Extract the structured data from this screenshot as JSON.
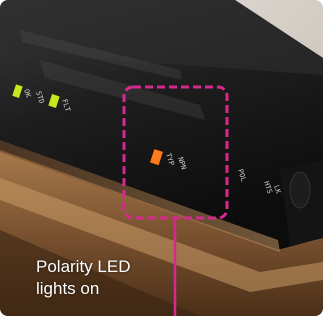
{
  "photo": {
    "subject_icon": "hardware-module-photo",
    "body_label_1": "OK",
    "body_label_2": "STD",
    "body_label_3": "FLT",
    "body_label_4": "TYP",
    "body_label_5": "NPN",
    "body_label_6": "POL",
    "body_label_7": "HTS",
    "body_label_8": "LK"
  },
  "callout": {
    "line1": "Polarity LED",
    "line2": "lights on",
    "highlight_color": "#d6298f",
    "indicator_color": "#ff7a1a",
    "status_color": "#c7e81c"
  }
}
